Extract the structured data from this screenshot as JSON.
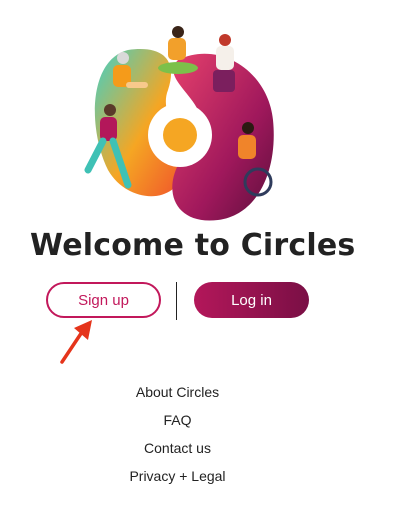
{
  "welcome": {
    "title": "Welcome to Circles"
  },
  "actions": {
    "signup_label": "Sign up",
    "login_label": "Log in"
  },
  "footer_links": [
    "About Circles",
    "FAQ",
    "Contact us",
    "Privacy + Legal"
  ],
  "colors": {
    "brand": "#c2185b",
    "brand_dark": "#7a0f45",
    "annotation_arrow": "#e5341b",
    "text": "#222222"
  }
}
